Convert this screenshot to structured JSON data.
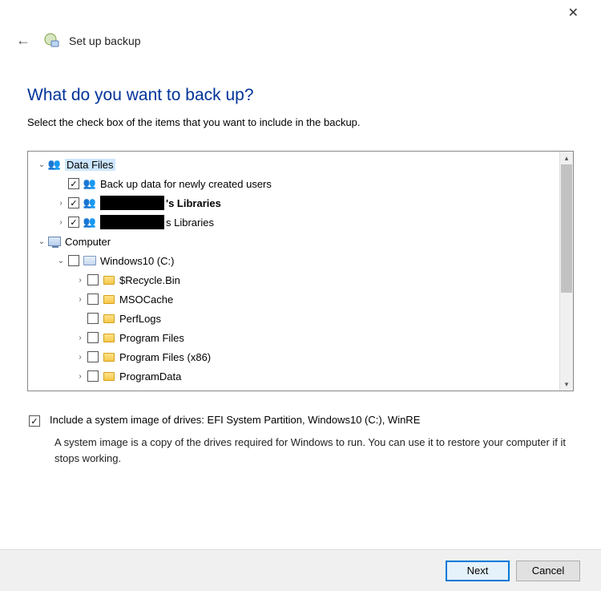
{
  "titlebar": {
    "close": "✕"
  },
  "header": {
    "back": "←",
    "title": "Set up backup"
  },
  "main": {
    "question": "What do you want to back up?",
    "instruction": "Select the check box of the items that you want to include in the backup."
  },
  "tree": {
    "dataFiles": {
      "label": "Data Files",
      "children": {
        "newUsers": "Back up data for newly created users",
        "lib1_suffix": "'s Libraries",
        "lib2_suffix": "s Libraries"
      }
    },
    "computer": {
      "label": "Computer",
      "drive": {
        "label": "Windows10 (C:)",
        "folders": {
          "recycle": "$Recycle.Bin",
          "msocache": "MSOCache",
          "perflogs": "PerfLogs",
          "progfiles": "Program Files",
          "progfiles86": "Program Files (x86)",
          "progdata": "ProgramData"
        }
      }
    }
  },
  "systemImage": {
    "label": "Include a system image of drives: EFI System Partition, Windows10 (C:), WinRE",
    "desc": "A system image is a copy of the drives required for Windows to run. You can use it to restore your computer if it stops working."
  },
  "footer": {
    "next": "Next",
    "cancel": "Cancel"
  }
}
